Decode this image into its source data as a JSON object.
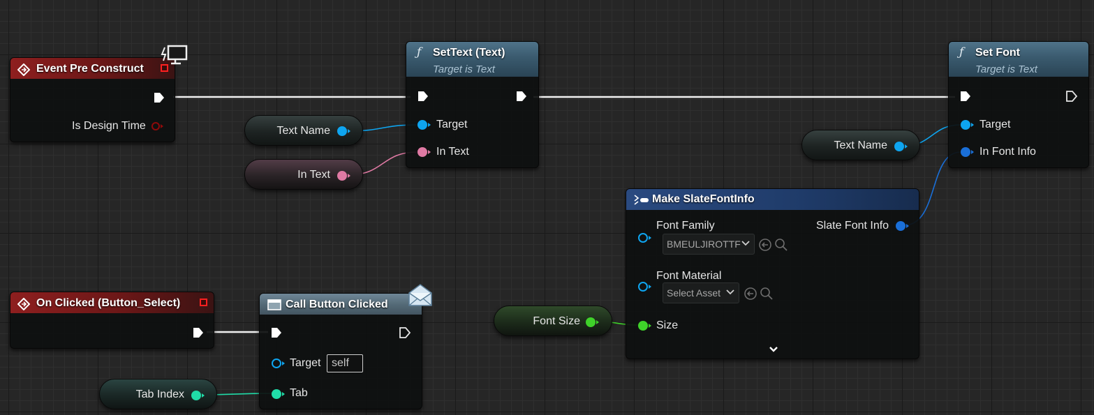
{
  "nodes": {
    "event_pre_construct": {
      "title": "Event Pre Construct",
      "pin_is_design_time": "Is Design Time"
    },
    "settext": {
      "title": "SetText (Text)",
      "subtitle": "Target is Text",
      "pin_target": "Target",
      "pin_in_text": "In Text"
    },
    "setfont": {
      "title": "Set Font",
      "subtitle": "Target is Text",
      "pin_target": "Target",
      "pin_in_font_info": "In Font Info"
    },
    "make_slate_font_info": {
      "title": "Make SlateFontInfo",
      "pin_font_family": "Font Family",
      "font_family_value": "BMEULJIROTTF",
      "pin_font_material": "Font Material",
      "font_material_value": "Select Asset",
      "pin_size": "Size",
      "output_slate_font_info": "Slate Font Info"
    },
    "on_clicked": {
      "title": "On Clicked (Button_Select)"
    },
    "call_button_clicked": {
      "title": "Call Button Clicked",
      "pin_target": "Target",
      "target_value": "self",
      "pin_tab": "Tab"
    }
  },
  "variables": {
    "text_name_1": "Text Name",
    "in_text": "In Text",
    "text_name_2": "Text Name",
    "font_size": "Font Size",
    "tab_index": "Tab Index"
  },
  "colors": {
    "exec_wire": "#f2f2f2",
    "object_pin": "#0ea5f0",
    "text_pin": "#e07aa4",
    "struct_pin": "#1a6fd8",
    "float_pin": "#3fd22a",
    "int_pin": "#20dca8",
    "event_header": "#8e1f1f",
    "function_header": "#3f5f74",
    "make_header": "#234379"
  }
}
